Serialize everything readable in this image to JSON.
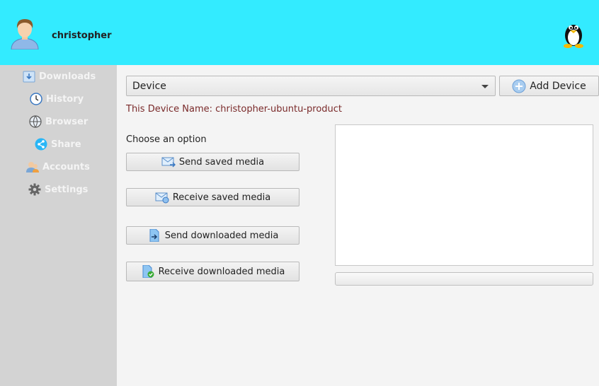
{
  "header": {
    "username": "christopher",
    "avatar_icon": "user-avatar-icon",
    "os_icon": "linux-tux-icon",
    "background_color": "#33ebff"
  },
  "sidebar": {
    "items": [
      {
        "label": "Downloads",
        "icon": "downloads-icon"
      },
      {
        "label": "History",
        "icon": "clock-icon"
      },
      {
        "label": "Browser",
        "icon": "globe-icon"
      },
      {
        "label": "Share",
        "icon": "share-icon"
      },
      {
        "label": "Accounts",
        "icon": "accounts-icon"
      },
      {
        "label": "Settings",
        "icon": "gear-icon"
      }
    ]
  },
  "main": {
    "device_select": {
      "value": "Device"
    },
    "add_device_label": "Add Device",
    "device_name_text": "This Device Name: christopher-ubuntu-product",
    "choose_label": "Choose an option",
    "buttons": [
      {
        "label": "Send saved media",
        "icon": "mail-send-icon"
      },
      {
        "label": "Receive saved media",
        "icon": "mail-receive-icon"
      },
      {
        "label": "Send downloaded media",
        "icon": "file-send-icon"
      },
      {
        "label": "Receive downloaded media",
        "icon": "file-received-icon"
      }
    ],
    "progress_fraction": 0
  }
}
